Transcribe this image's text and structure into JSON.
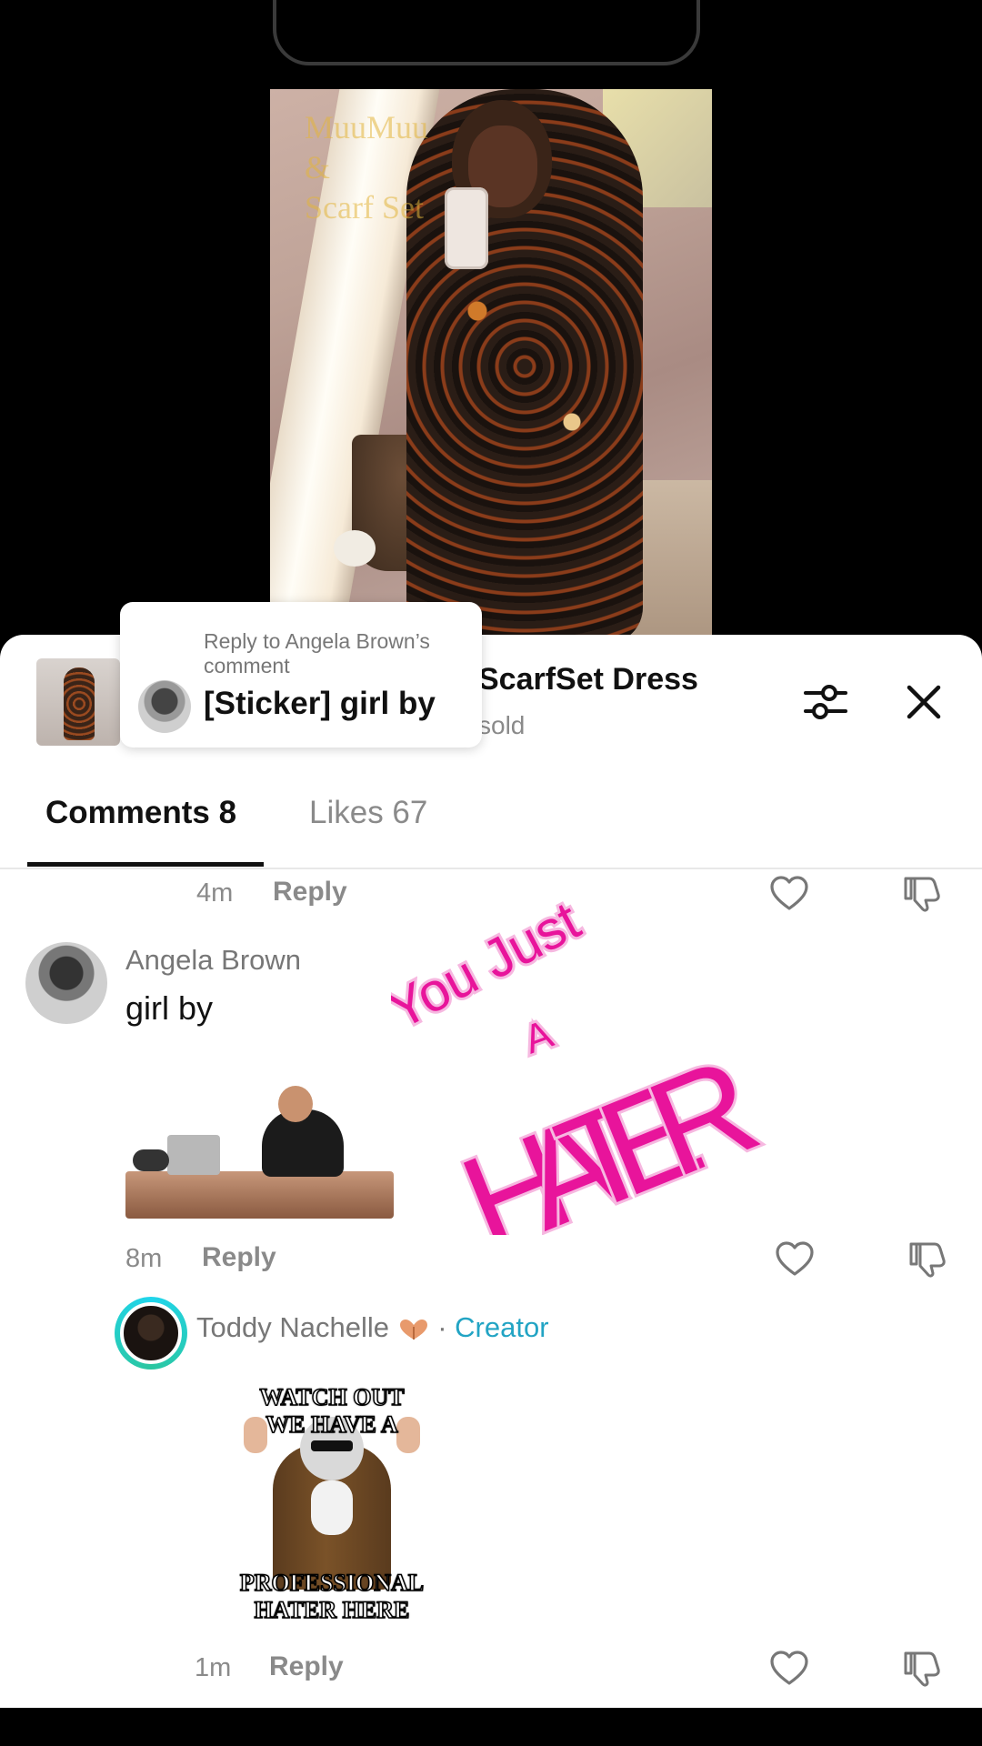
{
  "video": {
    "overlay_lines": [
      "MuuMuu",
      "&",
      "Scarf Set"
    ]
  },
  "product": {
    "title": "ScarfSet Dress",
    "sub": "sold"
  },
  "reply_popup": {
    "label": "Reply to Angela Brown’s comment",
    "text": "[Sticker] girl by"
  },
  "tabs": {
    "comments": "Comments 8",
    "likes": "Likes 67"
  },
  "comments": [
    {
      "time": "4m",
      "reply_label": "Reply"
    },
    {
      "author": "Angela Brown",
      "text": "girl by",
      "time": "8m",
      "reply_label": "Reply",
      "sticker_hater": {
        "line1": "You Just",
        "line2": "A",
        "line3": "HATER"
      }
    },
    {
      "author": "Toddy Nachelle",
      "badge_sep": " · ",
      "badge": "Creator",
      "time": "1m",
      "reply_label": "Reply",
      "sticker_caption_top": [
        "WATCH OUT",
        "WE HAVE A"
      ],
      "sticker_caption_bottom": [
        "PROFESSIONAL",
        "HATER HERE"
      ]
    }
  ],
  "colors": {
    "creator": "#22a4c4",
    "hater_pink": "#e8149b",
    "muted": "#8a8a8a"
  },
  "icons": [
    "filter-icon",
    "close-icon",
    "heart-icon",
    "dislike-icon",
    "heart-hands-icon"
  ]
}
